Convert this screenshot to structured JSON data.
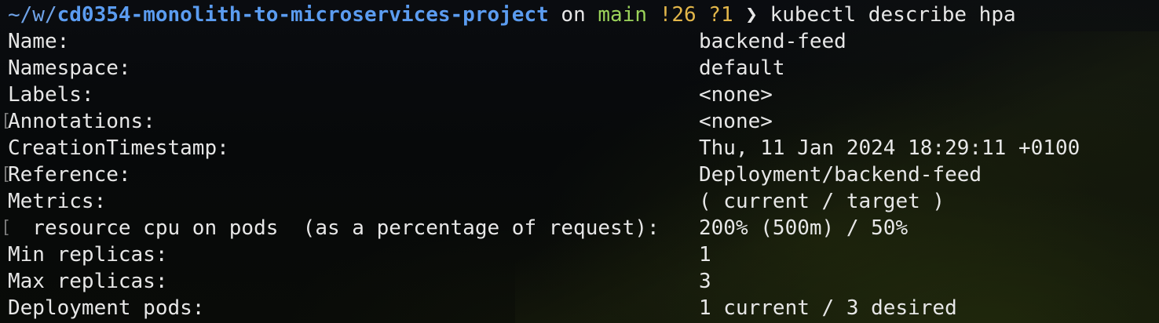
{
  "prompt": {
    "path_prefix": "~/w/",
    "directory": "cd0354-monolith-to-microservices-project",
    "on_word": "on",
    "branch": "main",
    "git_status": "!26 ?1",
    "chevron": "❯",
    "command": "kubectl describe hpa"
  },
  "rows": [
    {
      "key": "Name:",
      "value": "backend-feed"
    },
    {
      "key": "Namespace:",
      "value": "default"
    },
    {
      "key": "Labels:",
      "value": "<none>"
    },
    {
      "key": "Annotations:",
      "value": "<none>"
    },
    {
      "key": "CreationTimestamp:",
      "value": "Thu, 11 Jan 2024 18:29:11 +0100"
    },
    {
      "key": "Reference:",
      "value": "Deployment/backend-feed"
    },
    {
      "key": "Metrics:",
      "value": "( current / target )"
    },
    {
      "key": "  resource cpu on pods  (as a percentage of request):",
      "value": "200% (500m) / 50%"
    },
    {
      "key": "Min replicas:",
      "value": "1"
    },
    {
      "key": "Max replicas:",
      "value": "3"
    },
    {
      "key": "Deployment pods:",
      "value": "1 current / 3 desired"
    }
  ],
  "bracket_glyph": "["
}
